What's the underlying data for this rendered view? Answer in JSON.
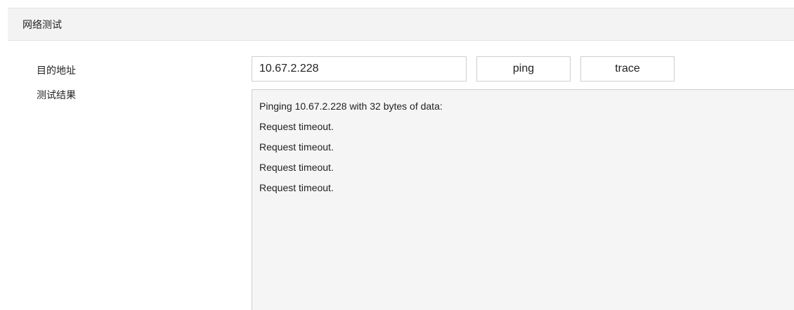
{
  "section": {
    "title": "网络测试"
  },
  "form": {
    "target_label": "目的地址",
    "target_value": "10.67.2.228",
    "ping_label": "ping",
    "trace_label": "trace",
    "result_label": "测试结果"
  },
  "result": {
    "lines": [
      "Pinging 10.67.2.228 with 32 bytes of data:",
      "Request timeout.",
      "Request timeout.",
      "Request timeout.",
      "Request timeout."
    ]
  }
}
